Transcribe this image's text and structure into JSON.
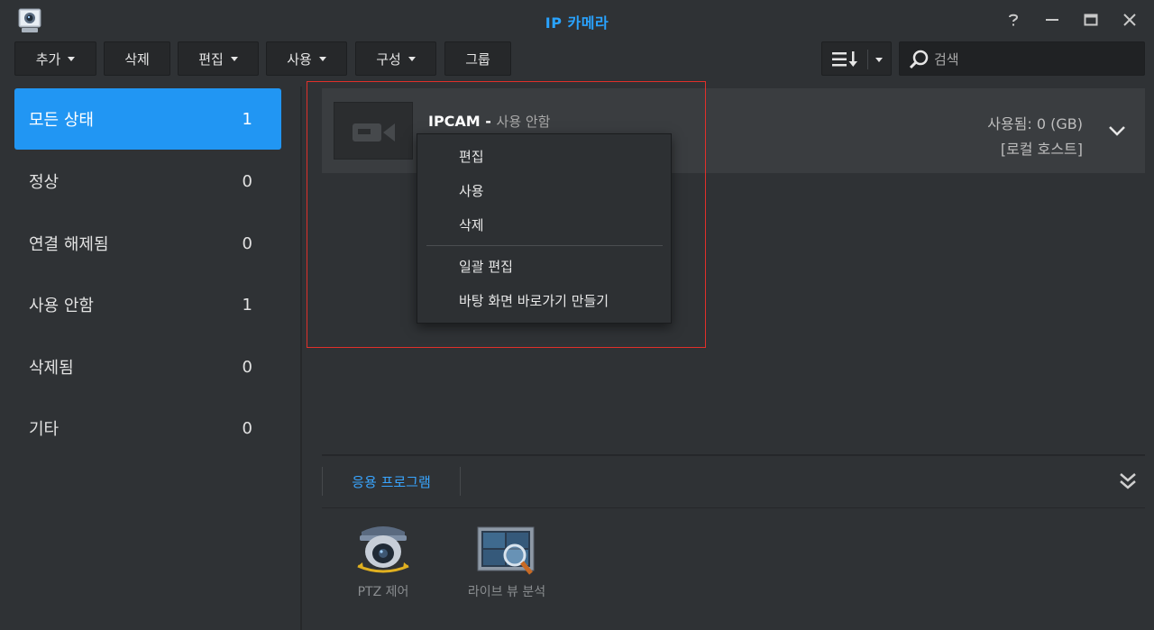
{
  "window": {
    "title": "IP 카메라"
  },
  "toolbar": {
    "add_label": "추가",
    "delete_label": "삭제",
    "edit_label": "편집",
    "enable_label": "사용",
    "config_label": "구성",
    "group_label": "그룹"
  },
  "search": {
    "placeholder": "검색"
  },
  "sidebar": {
    "items": [
      {
        "label": "모든 상태",
        "count": "1"
      },
      {
        "label": "정상",
        "count": "0"
      },
      {
        "label": "연결 해제됨",
        "count": "0"
      },
      {
        "label": "사용 안함",
        "count": "1"
      },
      {
        "label": "삭제됨",
        "count": "0"
      },
      {
        "label": "기타",
        "count": "0"
      }
    ]
  },
  "camera": {
    "name": "IPCAM",
    "separator": " - ",
    "status": "사용 안함",
    "usage": "사용됨: 0 (GB)",
    "host": "[로컬 호스트]"
  },
  "context_menu": {
    "items": [
      "편집",
      "사용",
      "삭제",
      "일괄 편집",
      "바탕 화면 바로가기 만들기"
    ]
  },
  "bottom_panel": {
    "tab_label": "응용 프로그램",
    "apps": [
      {
        "label": "PTZ 제어",
        "icon": "ptz-camera-icon"
      },
      {
        "label": "라이브 뷰 분석",
        "icon": "live-view-analytics-icon"
      }
    ]
  },
  "colors": {
    "accent": "#2196f3",
    "title": "#29a3ff",
    "highlight_border": "#e0302a"
  }
}
